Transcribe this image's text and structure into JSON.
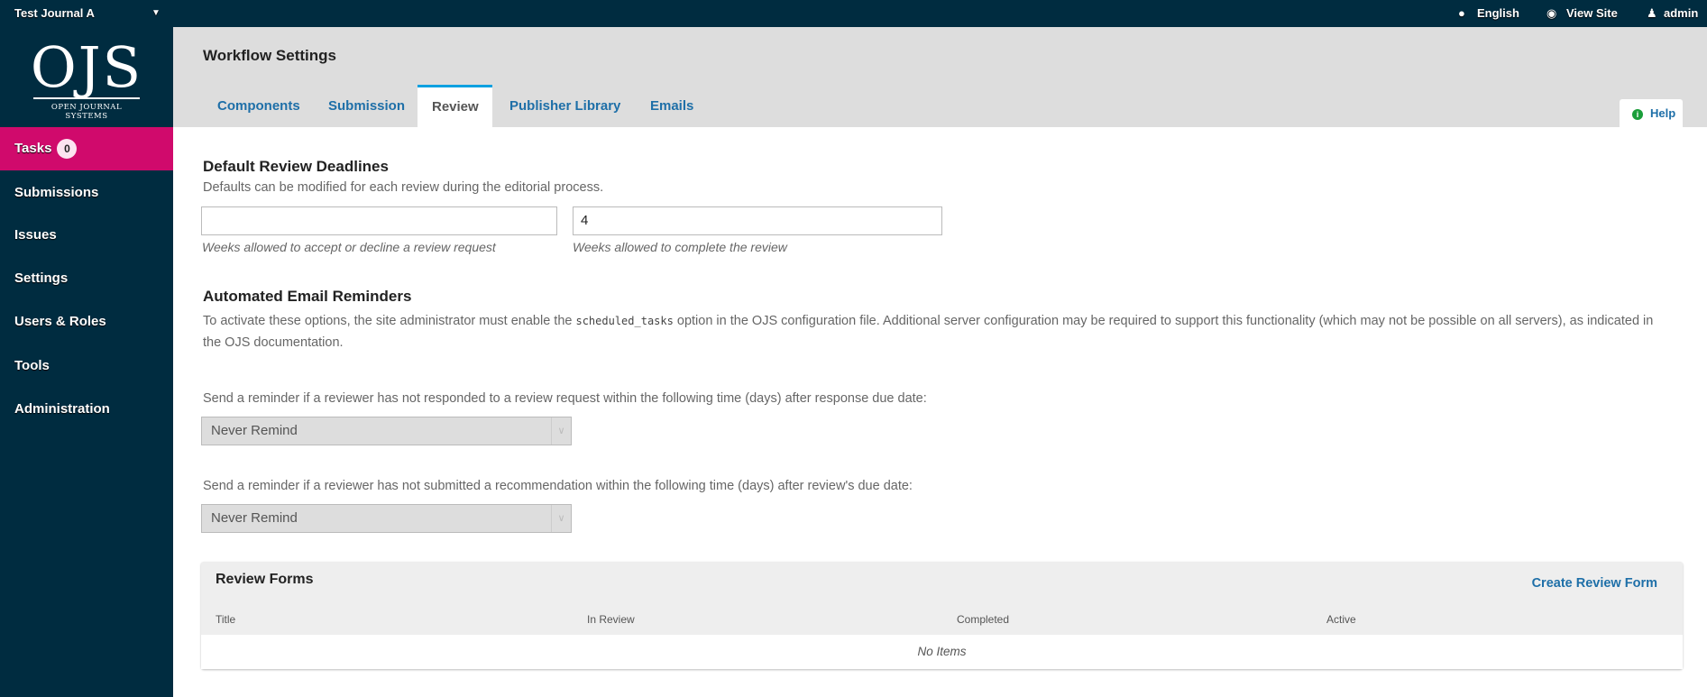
{
  "topbar": {
    "journal": "Test Journal A",
    "language": "English",
    "view_site": "View Site",
    "user": "admin"
  },
  "logo": {
    "big": "OJS",
    "small": "OPEN JOURNAL SYSTEMS"
  },
  "sidebar": {
    "tasks": {
      "label": "Tasks",
      "count": "0"
    },
    "items": [
      "Submissions",
      "Issues",
      "Settings",
      "Users & Roles",
      "Tools",
      "Administration"
    ]
  },
  "header": {
    "title": "Workflow Settings",
    "tabs": [
      "Components",
      "Submission",
      "Review",
      "Publisher Library",
      "Emails"
    ],
    "active_tab": "Review",
    "help": "Help"
  },
  "deadlines": {
    "heading": "Default Review Deadlines",
    "description": "Defaults can be modified for each review during the editorial process.",
    "accept_value": "",
    "accept_help": "Weeks allowed to accept or decline a review request",
    "complete_value": "4",
    "complete_help": "Weeks allowed to complete the review"
  },
  "reminders": {
    "heading": "Automated Email Reminders",
    "text_before": "To activate these options, the site administrator must enable the ",
    "code": "scheduled_tasks",
    "text_after": " option in the OJS configuration file. Additional server configuration may be required to support this functionality (which may not be possible on all servers), as indicated in the OJS documentation.",
    "response_label": "Send a reminder if a reviewer has not responded to a review request within the following time (days) after response due date:",
    "response_value": "Never Remind",
    "submit_label": "Send a reminder if a reviewer has not submitted a recommendation within the following time (days) after review's due date:",
    "submit_value": "Never Remind"
  },
  "review_forms": {
    "title": "Review Forms",
    "create": "Create Review Form",
    "columns": [
      "Title",
      "In Review",
      "Completed",
      "Active"
    ],
    "empty": "No Items"
  }
}
